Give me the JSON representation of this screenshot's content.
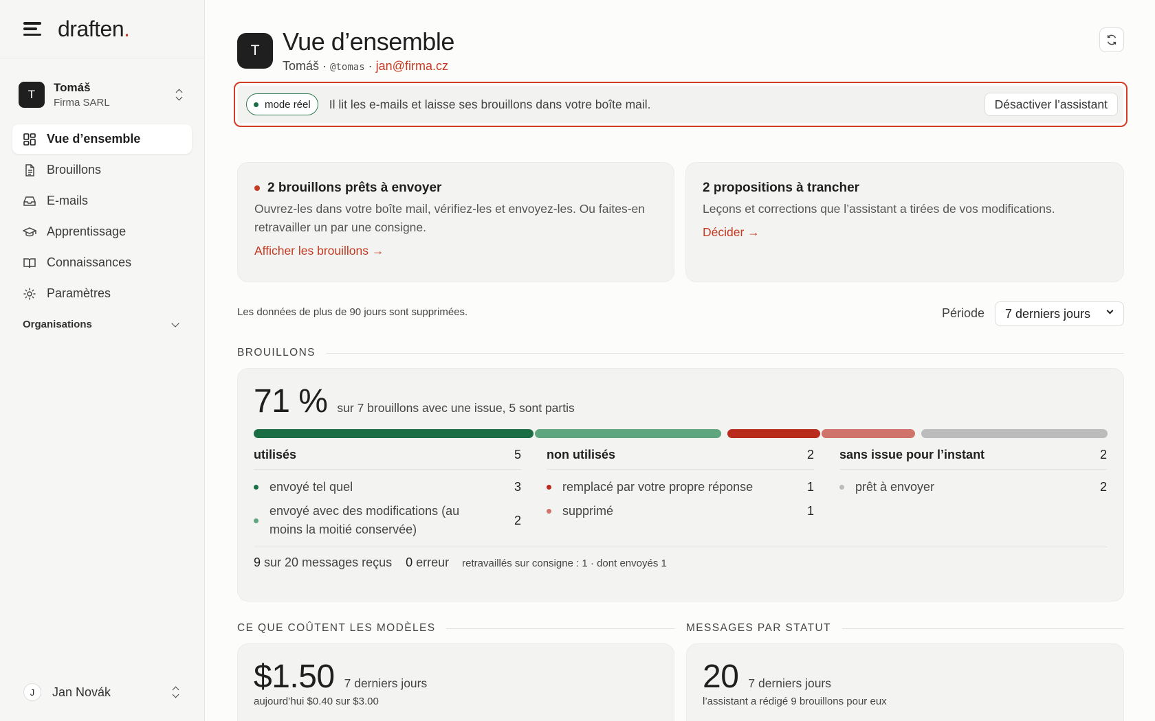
{
  "brand": {
    "name": "draften",
    "dot": "."
  },
  "account": {
    "initial": "T",
    "name": "Tomáš",
    "org": "Firma SARL"
  },
  "nav": [
    {
      "label": "Vue d’ensemble",
      "icon": "grid-icon",
      "active": true
    },
    {
      "label": "Brouillons",
      "icon": "document-icon"
    },
    {
      "label": "E-mails",
      "icon": "inbox-icon"
    },
    {
      "label": "Apprentissage",
      "icon": "graduation-cap-icon"
    },
    {
      "label": "Connaissances",
      "icon": "book-icon"
    },
    {
      "label": "Paramètres",
      "icon": "gear-icon"
    }
  ],
  "orgs_label": "Organisations",
  "user": {
    "initial": "J",
    "name": "Jan Novák"
  },
  "header": {
    "initial": "T",
    "title": "Vue d’ensemble",
    "name": "Tomáš",
    "sep": "·",
    "handle": "@tomas",
    "email": "jan@firma.cz"
  },
  "banner": {
    "pill": "mode réel",
    "text": "Il lit les e-mails et laisse ses brouillons dans votre boîte mail.",
    "button": "Désactiver l’assistant"
  },
  "cards": {
    "drafts": {
      "title": "2 brouillons prêts à envoyer",
      "body": "Ouvrez-les dans votre boîte mail, vérifiez-les et envoyez-les. Ou faites-en retravailler un par une consigne.",
      "link": "Afficher les brouillons →"
    },
    "proposals": {
      "title": "2 propositions à trancher",
      "body": "Leçons et corrections que l’assistant a tirées de vos modifications.",
      "link": "Décider →"
    }
  },
  "retention_note": "Les données de plus de 90 jours sont supprimées.",
  "period": {
    "label": "Période",
    "selected": "7 derniers jours"
  },
  "brouillons": {
    "section": "BROUILLONS",
    "percent": "71 %",
    "summary": "sur 7 brouillons avec une issue, 5 sont partis",
    "segments": [
      {
        "value": 3,
        "color": "#1b6e44"
      },
      {
        "value": 2,
        "color": "#5fa57d"
      },
      {
        "value": 1,
        "color": "#b92b1d"
      },
      {
        "value": 1,
        "color": "#d0736a"
      },
      {
        "value": 2,
        "color": "#bcbcbc"
      }
    ],
    "columns": [
      {
        "title": "utilisés",
        "total": "5",
        "rows": [
          {
            "label": "envoyé tel quel",
            "value": "3",
            "color": "#1b6e44"
          },
          {
            "label": "envoyé avec des modifications (au moins la moitié conservée)",
            "value": "2",
            "color": "#5fa57d"
          }
        ]
      },
      {
        "title": "non utilisés",
        "total": "2",
        "rows": [
          {
            "label": "remplacé par votre propre réponse",
            "value": "1",
            "color": "#b92b1d"
          },
          {
            "label": "supprimé",
            "value": "1",
            "color": "#d0736a"
          }
        ]
      },
      {
        "title": "sans issue pour l’instant",
        "total": "2",
        "rows": [
          {
            "label": "prêt à envoyer",
            "value": "2",
            "color": "#bcbcbc"
          }
        ]
      }
    ],
    "footer": {
      "received_num": "9",
      "received_text": "sur 20 messages reçus",
      "errors_num": "0",
      "errors_text": "erreur",
      "reworked": "retravaillés sur consigne : 1 · dont envoyés 1"
    }
  },
  "costs": {
    "section": "CE QUE COÛTENT LES MODÈLES",
    "amount": "$1.50",
    "period": "7 derniers jours",
    "today": "aujourd’hui $0.40 sur $3.00"
  },
  "status": {
    "section": "MESSAGES PAR STATUT",
    "count": "20",
    "period": "7 derniers jours",
    "note": "l’assistant a rédigé 9 brouillons pour eux"
  }
}
